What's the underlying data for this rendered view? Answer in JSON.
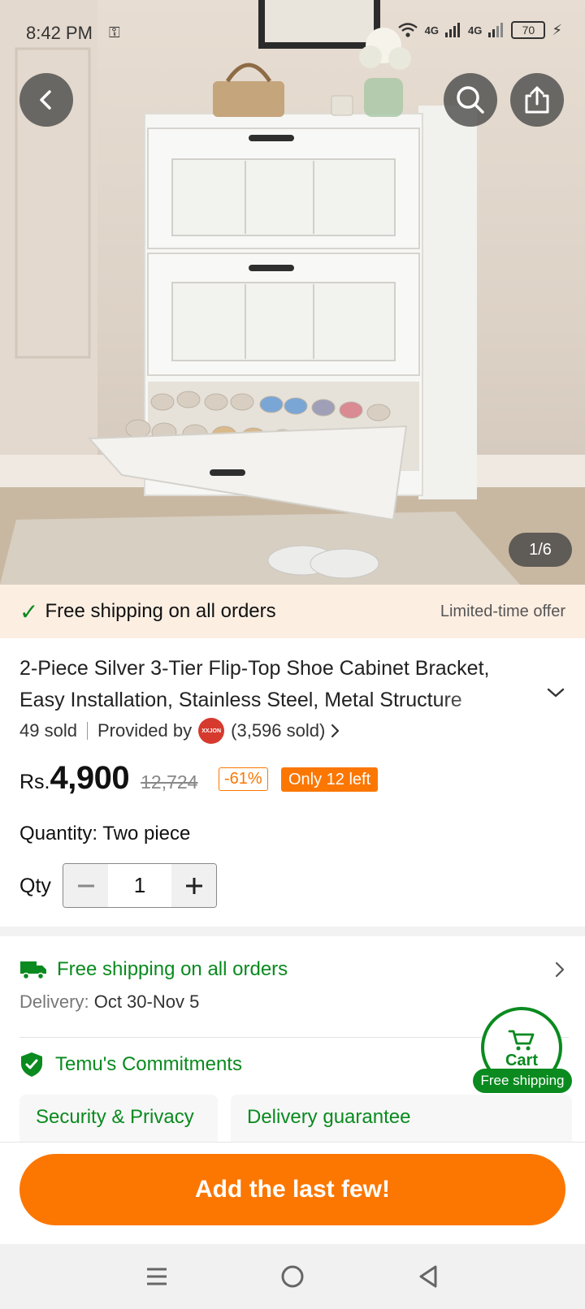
{
  "status_bar": {
    "time": "8:42 PM",
    "network_1": "4G",
    "network_2": "4G",
    "battery": "70"
  },
  "gallery": {
    "page_indicator": "1/6"
  },
  "offer_banner": {
    "text": "Free shipping on all orders",
    "tag": "Limited-time offer"
  },
  "product": {
    "title_line_1": "2-Piece Silver 3-Tier Flip-Top Shoe Cabinet Bracket,",
    "title_line_2": "Easy Installation, Stainless Steel, Metal Structure",
    "sold": "49 sold",
    "provided_by": "Provided by",
    "seller_logo_text": "XXJON",
    "seller_sold": "(3,596 sold)",
    "currency": "Rs.",
    "price": "4,900",
    "original_price": "12,724",
    "discount": "-61%",
    "stock": "Only 12 left",
    "quantity_option": "Quantity: Two piece",
    "qty_label": "Qty",
    "qty_value": "1"
  },
  "shipping": {
    "title": "Free shipping on all orders",
    "delivery_label": "Delivery:",
    "delivery_dates": "Oct 30-Nov 5"
  },
  "commitments": {
    "title": "Temu's Commitments",
    "cards": [
      {
        "title": "Security & Privacy"
      },
      {
        "title": "Delivery guarantee"
      }
    ]
  },
  "cart": {
    "label": "Cart",
    "badge": "Free shipping"
  },
  "cta": {
    "label": "Add the last few!"
  },
  "colors": {
    "accent_orange": "#fb7701",
    "green": "#0a8a1f",
    "banner_bg": "#fdeee2"
  }
}
